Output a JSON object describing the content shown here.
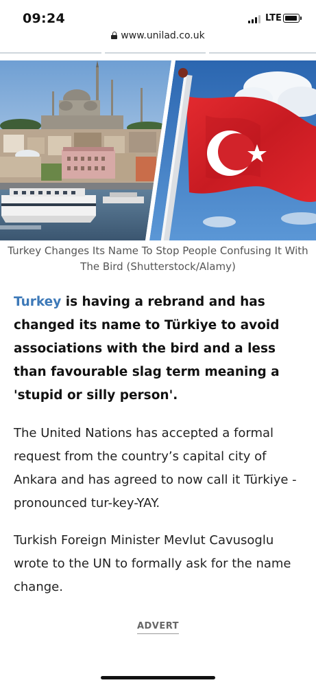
{
  "status_bar": {
    "time": "09:24",
    "network": "LTE"
  },
  "browser": {
    "url": "www.unilad.co.uk"
  },
  "hero": {
    "left_image": "istanbul-skyline-photo",
    "right_image": "turkish-flag-photo"
  },
  "article": {
    "caption": "Turkey Changes Its Name To Stop People Confusing It With The Bird (Shutterstock/Alamy)",
    "lead_link": "Turkey",
    "lead_rest": " is having a rebrand and has changed its name to Türkiye to avoid associations with the bird and a less than favourable slag term meaning a 'stupid or silly person'.",
    "paragraph_1": "The United Nations has accepted a formal request from the country’s capital city of Ankara and has agreed to now call it Türkiye - pronounced tur-key-YAY.",
    "paragraph_2": "Turkish Foreign Minister Mevlut Cavusoglu wrote to the UN to formally ask for the name change.",
    "advert_label": "ADVERT"
  },
  "colors": {
    "link": "#3d79b8",
    "flag_red": "#d6202a",
    "sky_blue": "#2f6fb5"
  }
}
